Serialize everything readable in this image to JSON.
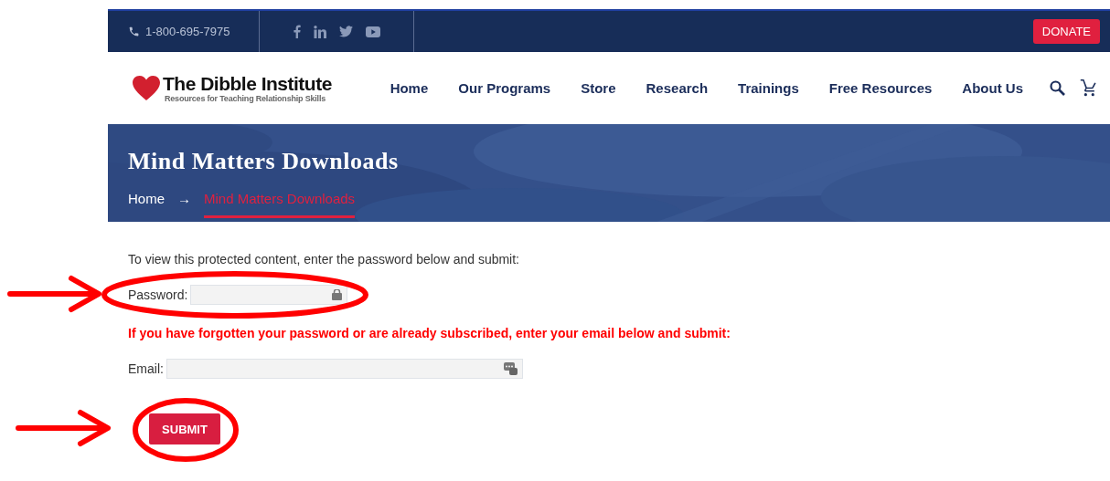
{
  "topbar": {
    "phone": "1-800-695-7975",
    "social": [
      {
        "kind": "facebook"
      },
      {
        "kind": "linkedin"
      },
      {
        "kind": "twitter"
      },
      {
        "kind": "youtube"
      }
    ],
    "donate": "DONATE"
  },
  "logo": {
    "name": "The Dibble Institute",
    "tagline": "Resources for Teaching Relationship Skills"
  },
  "nav": [
    {
      "label": "Home"
    },
    {
      "label": "Our Programs"
    },
    {
      "label": "Store"
    },
    {
      "label": "Research"
    },
    {
      "label": "Trainings"
    },
    {
      "label": "Free Resources"
    },
    {
      "label": "About Us"
    }
  ],
  "hero": {
    "title": "Mind Matters Downloads",
    "separator": "→",
    "breadcrumbs": [
      {
        "label": "Home",
        "selected": false
      },
      {
        "label": "Mind Matters Downloads",
        "selected": true
      }
    ]
  },
  "form": {
    "intro": "To view this protected content, enter the password below and submit:",
    "password_label": "Password:",
    "notice": "If you have forgotten your password or are already subscribed, enter your email below and submit:",
    "email_label": "Email:",
    "submit": "SUBMIT"
  }
}
